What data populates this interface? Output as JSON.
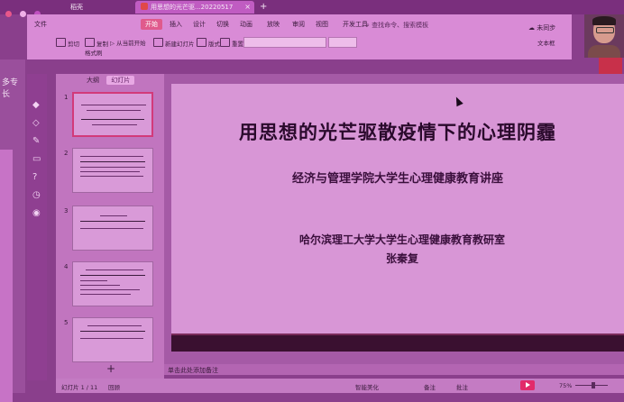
{
  "tabbar": {
    "home_tab": "稻壳",
    "doc_tab": "用思想的光芒驱...20220517",
    "close": "×",
    "add": "+"
  },
  "ribbon": {
    "file_menu": "文件",
    "menus": [
      "开始",
      "插入",
      "设计",
      "切换",
      "动画",
      "放映",
      "审阅",
      "视图",
      "开发工具"
    ],
    "search": "查找命令、搜索模板",
    "cloud": "未同步",
    "tools": [
      "剪切",
      "复制",
      "格式刷",
      "从当前开始",
      "新建幻灯片",
      "版式",
      "重置"
    ],
    "text_tool": "文本框"
  },
  "bgapp": {
    "caption": "多专长"
  },
  "thumbs_panel": {
    "tab_outline": "大纲",
    "tab_slides": "幻灯片",
    "numbers": [
      "1",
      "2",
      "3",
      "4",
      "5"
    ],
    "add": "+"
  },
  "slide": {
    "title": "用思想的光芒驱散疫情下的心理阴霾",
    "subtitle": "经济与管理学院大学生心理健康教育讲座",
    "org": "哈尔滨理工大学大学生心理健康教育教研室",
    "author": "张秦复"
  },
  "notes": {
    "placeholder": "单击此处添加备注"
  },
  "status": {
    "slide_counter": "幻灯片 1 / 11",
    "theme": "回顾",
    "smart_beautify": "智能美化",
    "notes_btn": "备注",
    "comments_btn": "批注",
    "zoom": "75%",
    "zoom_fraction": 0.55
  },
  "colors": {
    "accent": "#e05a8c",
    "slide_bg": "#d896d6",
    "title_text": "#2a0a2c"
  },
  "icons": [
    "close-icon",
    "plus-icon",
    "cut-icon",
    "copy-icon",
    "play-icon",
    "search-icon",
    "cloud-icon"
  ]
}
